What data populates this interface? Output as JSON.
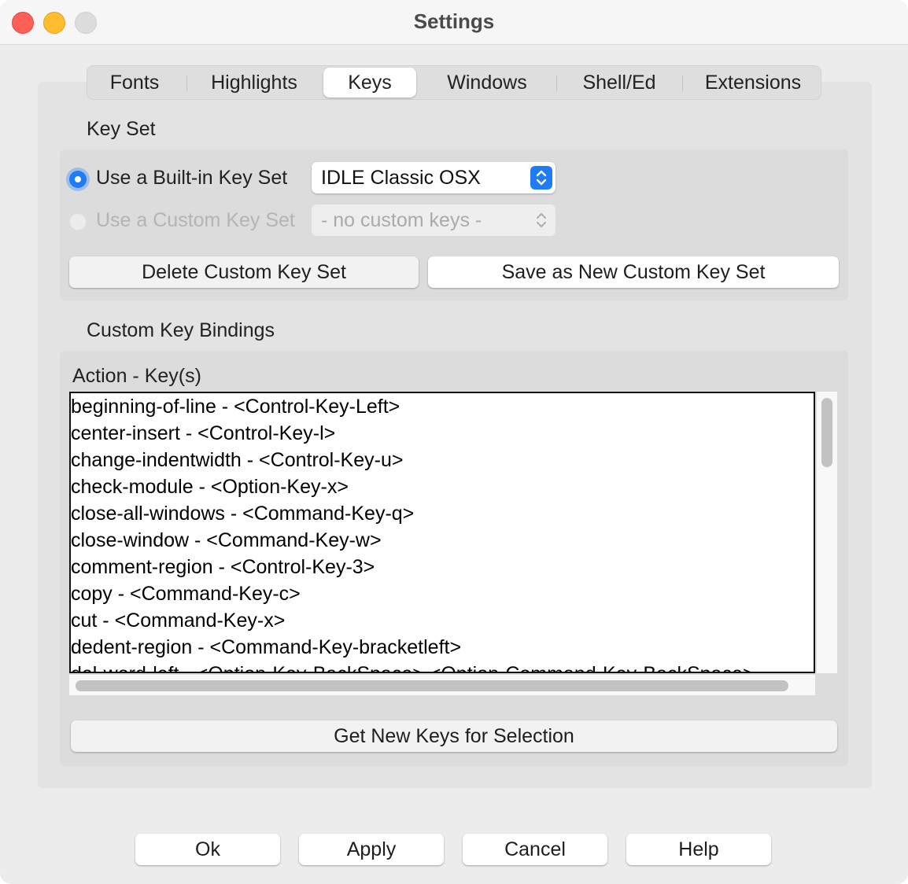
{
  "window": {
    "title": "Settings"
  },
  "tabs": [
    {
      "label": "Fonts"
    },
    {
      "label": "Highlights"
    },
    {
      "label": "Keys",
      "selected": true
    },
    {
      "label": "Windows"
    },
    {
      "label": "Shell/Ed"
    },
    {
      "label": "Extensions"
    }
  ],
  "key_set": {
    "section_label": "Key Set",
    "builtin_label": "Use a Built-in Key Set",
    "builtin_selected": true,
    "builtin_value": "IDLE Classic OSX",
    "custom_label": "Use a Custom Key Set",
    "custom_value": "- no custom keys -",
    "delete_button": "Delete Custom Key Set",
    "save_button": "Save as New Custom Key Set"
  },
  "bindings": {
    "section_label": "Custom Key Bindings",
    "list_header": "Action - Key(s)",
    "items": [
      "beginning-of-line - <Control-Key-Left>",
      "center-insert - <Control-Key-l>",
      "change-indentwidth - <Control-Key-u>",
      "check-module - <Option-Key-x>",
      "close-all-windows - <Command-Key-q>",
      "close-window - <Command-Key-w>",
      "comment-region - <Control-Key-3>",
      "copy - <Command-Key-c>",
      "cut - <Command-Key-x>",
      "dedent-region - <Command-Key-bracketleft>",
      "del-word-left - <Option-Key-BackSpace> <Option-Command-Key-BackSpace>"
    ],
    "get_keys_button": "Get New Keys for Selection"
  },
  "footer": {
    "ok": "Ok",
    "apply": "Apply",
    "cancel": "Cancel",
    "help": "Help"
  },
  "colors": {
    "accent": "#1f7cf5",
    "close": "#fe5f57",
    "minimize": "#febc2e",
    "maximize": "#dcdcdc"
  }
}
